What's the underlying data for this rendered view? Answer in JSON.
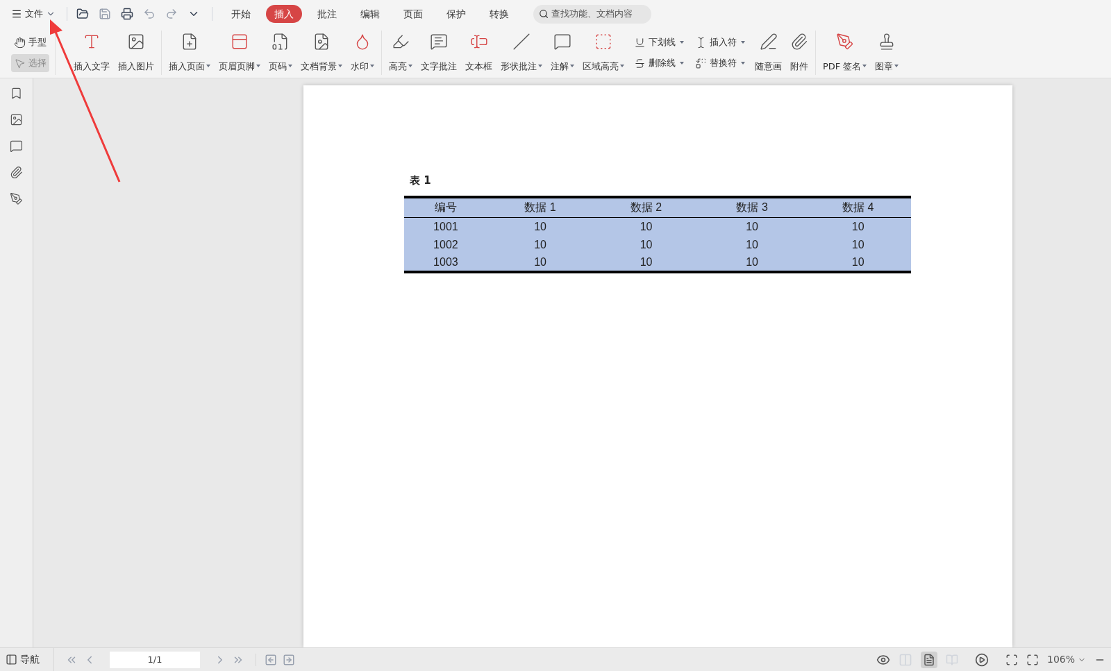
{
  "menu": {
    "label": "文件"
  },
  "tabs": [
    {
      "label": "开始",
      "selected": false
    },
    {
      "label": "插入",
      "selected": true
    },
    {
      "label": "批注",
      "selected": false
    },
    {
      "label": "编辑",
      "selected": false
    },
    {
      "label": "页面",
      "selected": false
    },
    {
      "label": "保护",
      "selected": false
    },
    {
      "label": "转换",
      "selected": false
    }
  ],
  "search": {
    "placeholder": "查找功能、文档内容"
  },
  "toolbar": {
    "groups": [
      {
        "items": [
          {
            "kind": "stack",
            "entries": [
              {
                "label": "手型",
                "selected": false
              },
              {
                "label": "选择",
                "selected": true
              }
            ]
          }
        ]
      },
      {
        "items": [
          {
            "kind": "large",
            "label": "插入文字",
            "dropdown": false
          },
          {
            "kind": "large",
            "label": "插入图片",
            "dropdown": false
          }
        ]
      },
      {
        "items": [
          {
            "kind": "large",
            "label": "插入页面",
            "dropdown": true
          },
          {
            "kind": "large",
            "label": "页眉页脚",
            "dropdown": true
          },
          {
            "kind": "large",
            "label": "页码",
            "dropdown": true
          },
          {
            "kind": "large",
            "label": "文档背景",
            "dropdown": true
          },
          {
            "kind": "large",
            "label": "水印",
            "dropdown": true
          }
        ]
      },
      {
        "items": [
          {
            "kind": "large",
            "label": "高亮",
            "dropdown": true
          },
          {
            "kind": "large",
            "label": "文字批注",
            "dropdown": false
          },
          {
            "kind": "large",
            "label": "文本框",
            "dropdown": false
          },
          {
            "kind": "large",
            "label": "形状批注",
            "dropdown": true
          },
          {
            "kind": "large",
            "label": "注解",
            "dropdown": true
          },
          {
            "kind": "large",
            "label": "区域高亮",
            "dropdown": true
          },
          {
            "kind": "stack",
            "entries": [
              {
                "label": "下划线",
                "dropdown": true
              },
              {
                "label": "删除线",
                "dropdown": true
              }
            ]
          },
          {
            "kind": "stack",
            "entries": [
              {
                "label": "插入符",
                "dropdown": true
              },
              {
                "label": "替换符",
                "dropdown": true
              }
            ]
          },
          {
            "kind": "large",
            "label": "随意画",
            "dropdown": false
          },
          {
            "kind": "large",
            "label": "附件",
            "dropdown": false
          }
        ]
      },
      {
        "items": [
          {
            "kind": "large",
            "label": "PDF 签名",
            "dropdown": true
          },
          {
            "kind": "large",
            "label": "图章",
            "dropdown": true
          }
        ]
      }
    ]
  },
  "document": {
    "caption": "表 1",
    "table": {
      "columns": [
        "编号",
        "数据 1",
        "数据 2",
        "数据 3",
        "数据 4"
      ],
      "rows": [
        [
          "1001",
          "10",
          "10",
          "10",
          "10"
        ],
        [
          "1002",
          "10",
          "10",
          "10",
          "10"
        ],
        [
          "1003",
          "10",
          "10",
          "10",
          "10"
        ]
      ]
    }
  },
  "status_bar": {
    "nav_label": "导航",
    "page_field": "1/1",
    "zoom": "106%"
  }
}
